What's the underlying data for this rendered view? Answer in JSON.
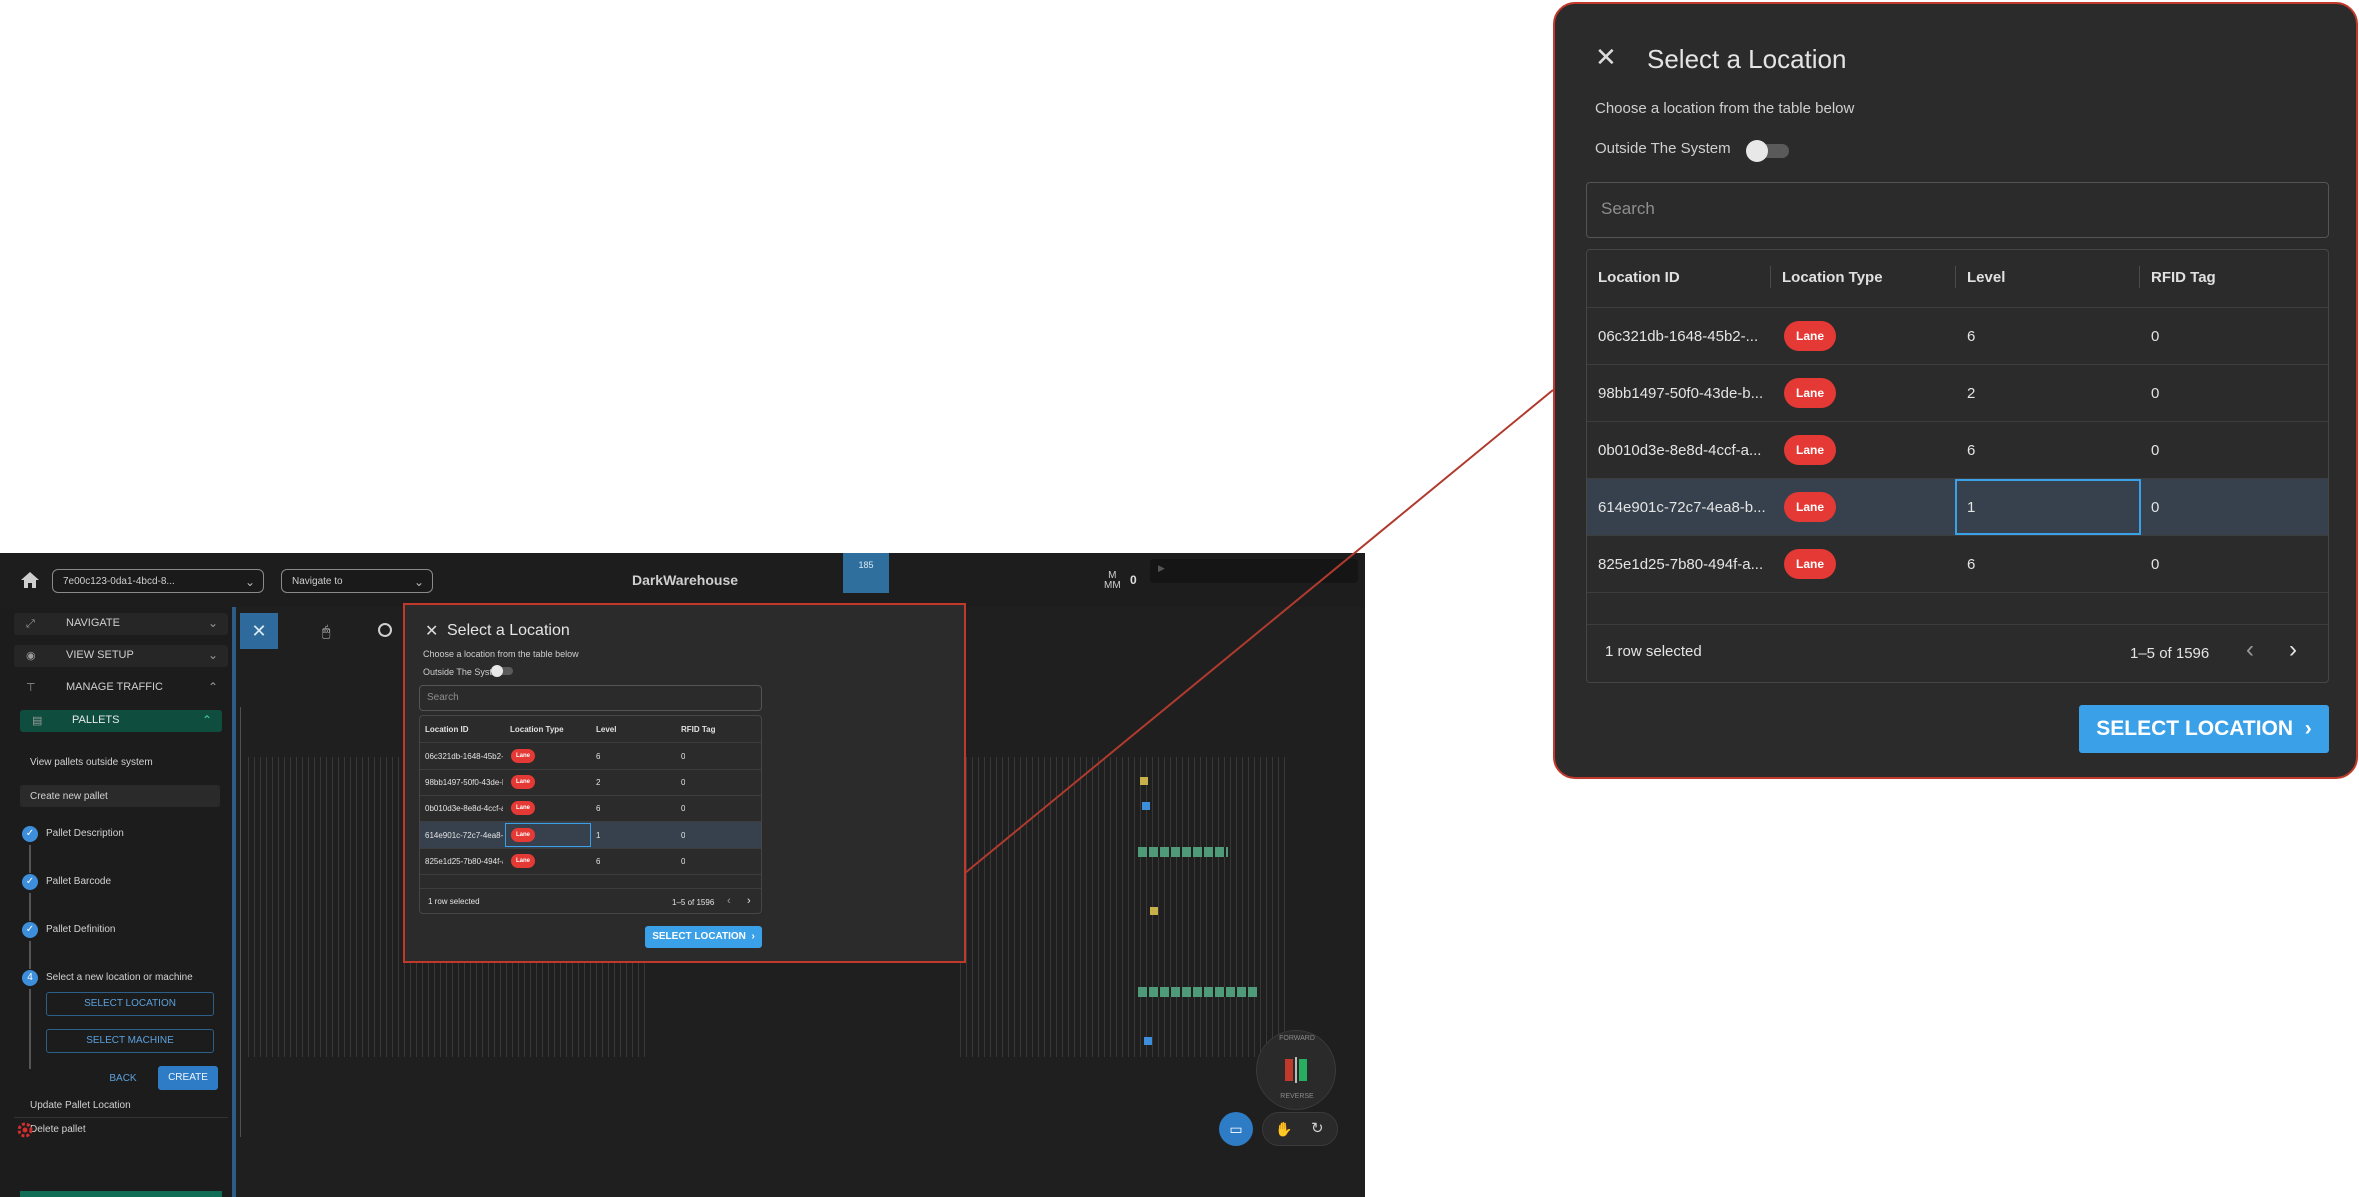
{
  "app": {
    "brand": "DarkWarehouse",
    "device_select": "7e00c123-0da1-4bcd-8...",
    "navigate_select": "Navigate to",
    "badge_number": "185",
    "mm_label_top": "M",
    "mm_label_bottom": "MM",
    "mm_count": "0"
  },
  "sidebar": {
    "navigate": "NAVIGATE",
    "view_setup": "VIEW SETUP",
    "manage_traffic": "MANAGE TRAFFIC",
    "pallets": "PALLETS",
    "view_outside": "View pallets outside system",
    "create_new": "Create new pallet",
    "steps": [
      {
        "label": "Pallet Description"
      },
      {
        "label": "Pallet Barcode"
      },
      {
        "label": "Pallet Definition"
      },
      {
        "label": "Select a new location or machine",
        "number": "4"
      }
    ],
    "select_location_btn": "SELECT LOCATION",
    "select_machine_btn": "SELECT MACHINE",
    "back_btn": "BACK",
    "create_btn": "CREATE",
    "update_location": "Update Pallet Location",
    "delete_pallet": "Delete pallet"
  },
  "direction": {
    "forward": "FORWARD",
    "reverse": "REVERSE"
  },
  "modal": {
    "title": "Select a Location",
    "subtitle": "Choose a location from the table below",
    "outside_label": "Outside The System",
    "outside_enabled": false,
    "search_placeholder": "Search",
    "columns": [
      "Location ID",
      "Location Type",
      "Level",
      "RFID Tag"
    ],
    "rows": [
      {
        "id_short": "06c321db-1648-45b2-...",
        "id_long": "06c321db-1648-45b2-...",
        "type": "Lane",
        "level": "6",
        "rfid": "0"
      },
      {
        "id_short": "98bb1497-50f0-43de-b...",
        "id_long": "98bb1497-50f0-43de-b...",
        "type": "Lane",
        "level": "2",
        "rfid": "0"
      },
      {
        "id_short": "0b010d3e-8e8d-4ccf-a...",
        "id_long": "0b010d3e-8e8d-4ccf-a...",
        "type": "Lane",
        "level": "6",
        "rfid": "0"
      },
      {
        "id_short": "614e901c-72c7-4ea8-b...",
        "id_long": "614e901c-72c7-4ea8-b...",
        "type": "Lane",
        "level": "1",
        "rfid": "0"
      },
      {
        "id_short": "825e1d25-7b80-494f-a...",
        "id_long": "825e1d25-7b80-494f-a...",
        "type": "Lane",
        "level": "6",
        "rfid": "0"
      }
    ],
    "selected_count": "1 row selected",
    "pagination": "1–5 of 1596",
    "select_button": "SELECT LOCATION"
  },
  "colors": {
    "accent": "#3aa0e8",
    "lane_chip": "#e53935",
    "highlight_border": "#c0392b",
    "pallets_green": "#0f4e3e"
  }
}
